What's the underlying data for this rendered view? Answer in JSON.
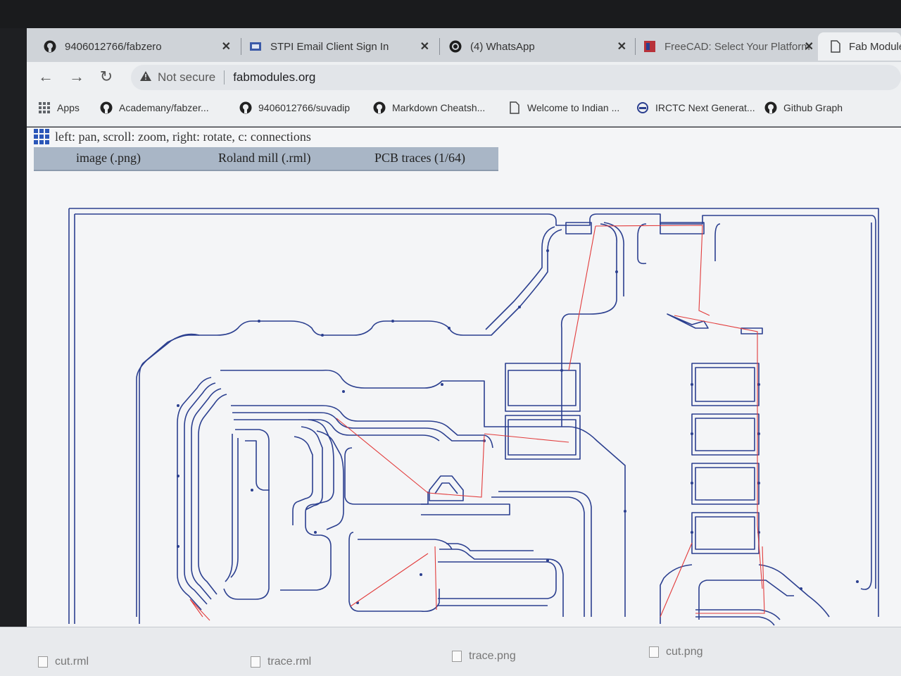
{
  "tabs": [
    {
      "title": "9406012766/fabzero",
      "icon": "github-icon"
    },
    {
      "title": "STPI Email Client Sign In",
      "icon": "stpi-icon"
    },
    {
      "title": "(4) WhatsApp",
      "icon": "whatsapp-icon"
    },
    {
      "title": "FreeCAD: Select Your Platform",
      "icon": "freecad-icon"
    },
    {
      "title": "Fab Module",
      "icon": "page-icon"
    }
  ],
  "toolbar": {
    "security_label": "Not secure",
    "url": "fabmodules.org"
  },
  "bookmarks": [
    {
      "label": "Apps",
      "icon": "apps-grid-icon"
    },
    {
      "label": "Academany/fabzer...",
      "icon": "github-icon"
    },
    {
      "label": "9406012766/suvadip",
      "icon": "github-icon"
    },
    {
      "label": "Markdown Cheatsh...",
      "icon": "github-icon"
    },
    {
      "label": "Welcome to Indian ...",
      "icon": "page-icon"
    },
    {
      "label": "IRCTC Next Generat...",
      "icon": "irctc-icon"
    },
    {
      "label": "Github Graph",
      "icon": "github-icon"
    }
  ],
  "page": {
    "hint": "left: pan, scroll: zoom, right: rotate, c: connections",
    "menu": [
      "image (.png)",
      "Roland mill (.rml)",
      "PCB traces (1/64)"
    ]
  },
  "downloads": [
    {
      "name": "cut.rml"
    },
    {
      "name": "trace.rml"
    },
    {
      "name": "trace.png"
    },
    {
      "name": "cut.png"
    }
  ],
  "colors": {
    "trace_path": "#2b3f8f",
    "connection_line": "#e23b3b",
    "menubar": "#a9b6c6"
  }
}
